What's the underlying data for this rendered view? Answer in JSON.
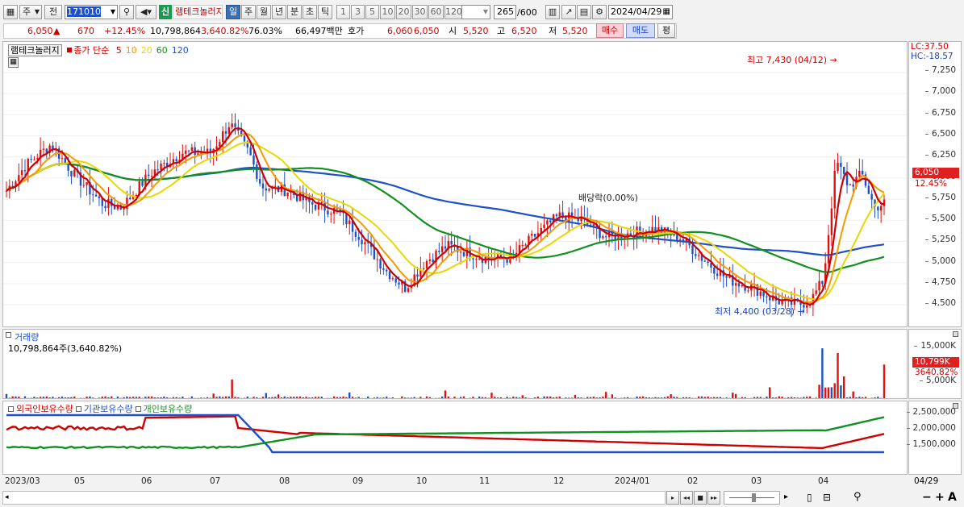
{
  "toolbar": {
    "type_select": "주",
    "prev_label": "전",
    "code": "171010",
    "credit_badge": "신",
    "stock_name": "램테크놀러지",
    "periods": [
      "일",
      "주",
      "월",
      "년",
      "분",
      "초",
      "틱"
    ],
    "active_period": "일",
    "intervals": [
      "1",
      "3",
      "5",
      "10",
      "20",
      "30",
      "60",
      "120"
    ],
    "count": "265",
    "count_max": "/600",
    "date": "2024/04/29"
  },
  "quote": {
    "price": "6,050",
    "arrow": "▲",
    "change": "670",
    "change_rate": "+12.45%",
    "volume": "10,798,864",
    "volume_rate": "3,640.82%",
    "turnover": "76.03%",
    "amount": "66,497백만",
    "ask_label": "호가",
    "ask1": "6,060",
    "bid1": "6,050",
    "open_label": "시",
    "open": "5,520",
    "high_label": "고",
    "high": "6,520",
    "low_label": "저",
    "low": "5,520",
    "buy_label": "매수",
    "sell_label": "매도",
    "eval_label": "평"
  },
  "price_panel": {
    "legend_name": "램테크놀러지",
    "legend_close": "종가 단순",
    "ma": [
      {
        "label": "5",
        "color": "#d00000"
      },
      {
        "label": "10",
        "color": "#f59a00"
      },
      {
        "label": "20",
        "color": "#e8d800"
      },
      {
        "label": "60",
        "color": "#129020"
      },
      {
        "label": "120",
        "color": "#1e50c8"
      }
    ],
    "lc": "LC:37.50",
    "hc": "HC:-18.57",
    "max_label": "최고 7,430 (04/12)",
    "min_label": "최저 4,400 (03/28)",
    "dividend_label": "배당락(0.00%)",
    "current_price_tag": "6,050",
    "current_rate_tag": "12.45%",
    "ticks": [
      "7,250",
      "7,000",
      "6,750",
      "6,500",
      "6,250",
      "6,000",
      "5,750",
      "5,500",
      "5,250",
      "5,000",
      "4,750",
      "4,500"
    ]
  },
  "volume_panel": {
    "title": "거래량",
    "value": "10,798,864주(3,640.82%)",
    "ticks": [
      "15,000K",
      "10,000K",
      "5,000K"
    ],
    "tag": "10,799K",
    "tag_rate": "3640.82%"
  },
  "holding_panel": {
    "legends": [
      {
        "label": "외국인보유수량",
        "color": "#d00000"
      },
      {
        "label": "기관보유수량",
        "color": "#1e50c8"
      },
      {
        "label": "개인보유수량",
        "color": "#129020"
      }
    ],
    "ticks": [
      "2,500,000",
      "2,000,000",
      "1,500,000"
    ]
  },
  "x_axis": {
    "labels": [
      "2023/03",
      "05",
      "06",
      "07",
      "08",
      "09",
      "10",
      "11",
      "12",
      "2024/01",
      "02",
      "03",
      "04"
    ],
    "last_date": "04/29"
  },
  "scroll_buttons": [
    "▸",
    "◂◂",
    "■",
    "▸▸"
  ],
  "zoom_buttons": [
    "−",
    "+",
    "A"
  ]
}
